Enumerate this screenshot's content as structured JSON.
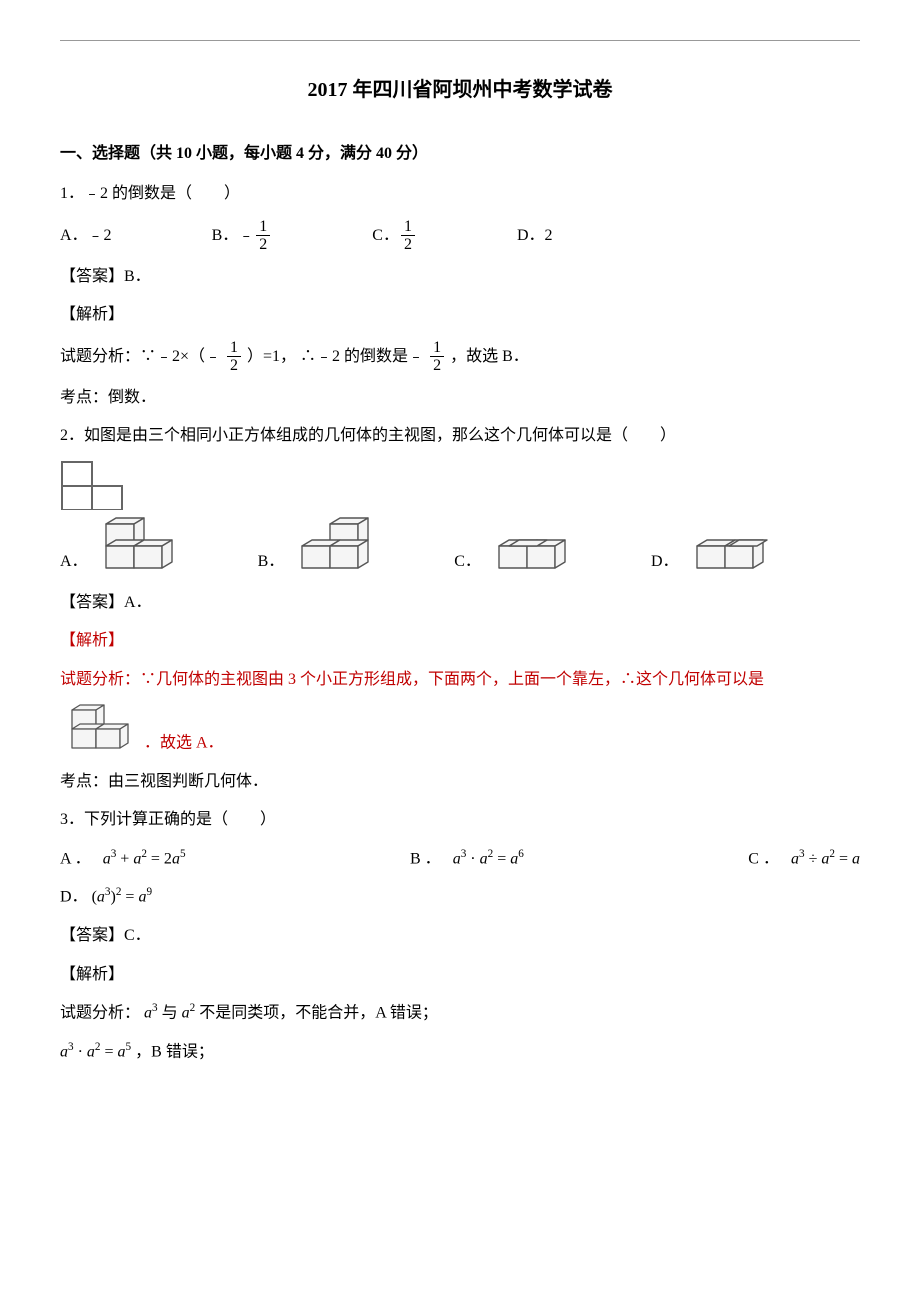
{
  "title": "2017 年四川省阿坝州中考数学试卷",
  "section1": "一、选择题（共 10 小题，每小题 4 分，满分 40 分）",
  "q1": {
    "stem": "1．﹣2 的倒数是（　　）",
    "optA_label": "A．﹣2",
    "optB_prefix": "B．",
    "optB_num": "1",
    "optB_den": "2",
    "optC_prefix": "C．",
    "optC_num": "1",
    "optC_den": "2",
    "optD_label": "D．2",
    "answer": "【答案】B．",
    "jiexi": "【解析】",
    "fx_p1": "试题分析：∵﹣2×（﹣",
    "fx_num": "1",
    "fx_den": "2",
    "fx_p2": "）=1， ∴﹣2 的倒数是﹣",
    "fx_p3": "，故选 B．",
    "kaodian": "考点：倒数．"
  },
  "q2": {
    "stem": "2．如图是由三个相同小正方体组成的几何体的主视图，那么这个几何体可以是（　　）",
    "optA": "A．",
    "optB": "B．",
    "optC": "C．",
    "optD": "D．",
    "answer": "【答案】A．",
    "jiexi": "【解析】",
    "fx1": "试题分析：∵几何体的主视图由 3 个小正方形组成，下面两个，上面一个靠左，∴这个几何体可以是",
    "fx2": "．故选 A．",
    "kaodian": "考点：由三视图判断几何体．"
  },
  "q3": {
    "stem": "3．下列计算正确的是（　　）",
    "optA_pre": "A ．　",
    "optB_pre": "B ．　",
    "optC_pre": "C ．　",
    "optD_pre": "D．",
    "answer": "【答案】C．",
    "jiexi": "【解析】",
    "fx_pre": "试题分析：",
    "fx_body": " 不是同类项，不能合并，A 错误；",
    "fx2_body": "，B 错误；"
  }
}
